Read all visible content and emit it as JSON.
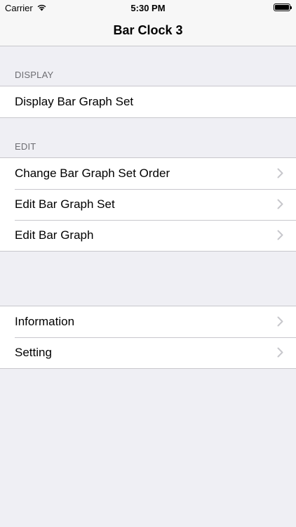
{
  "status_bar": {
    "carrier": "Carrier",
    "time": "5:30 PM"
  },
  "nav": {
    "title": "Bar Clock 3"
  },
  "sections": [
    {
      "header": "DISPLAY",
      "items": [
        {
          "label": "Display Bar Graph Set",
          "chevron": false
        }
      ]
    },
    {
      "header": "EDIT",
      "items": [
        {
          "label": "Change Bar Graph Set Order",
          "chevron": true
        },
        {
          "label": "Edit Bar Graph Set",
          "chevron": true
        },
        {
          "label": "Edit Bar Graph",
          "chevron": true
        }
      ]
    },
    {
      "header": "",
      "items": [
        {
          "label": "Information",
          "chevron": true
        },
        {
          "label": "Setting",
          "chevron": true
        }
      ]
    }
  ],
  "icons": {
    "signal": "wifi-icon",
    "battery": "battery-icon",
    "disclosure": "chevron-right-icon"
  },
  "colors": {
    "background": "#efeff4",
    "bar": "#f7f7f7",
    "separator": "#c8c7cc",
    "header_text": "#6d6d72",
    "chevron": "#c7c7cc"
  }
}
